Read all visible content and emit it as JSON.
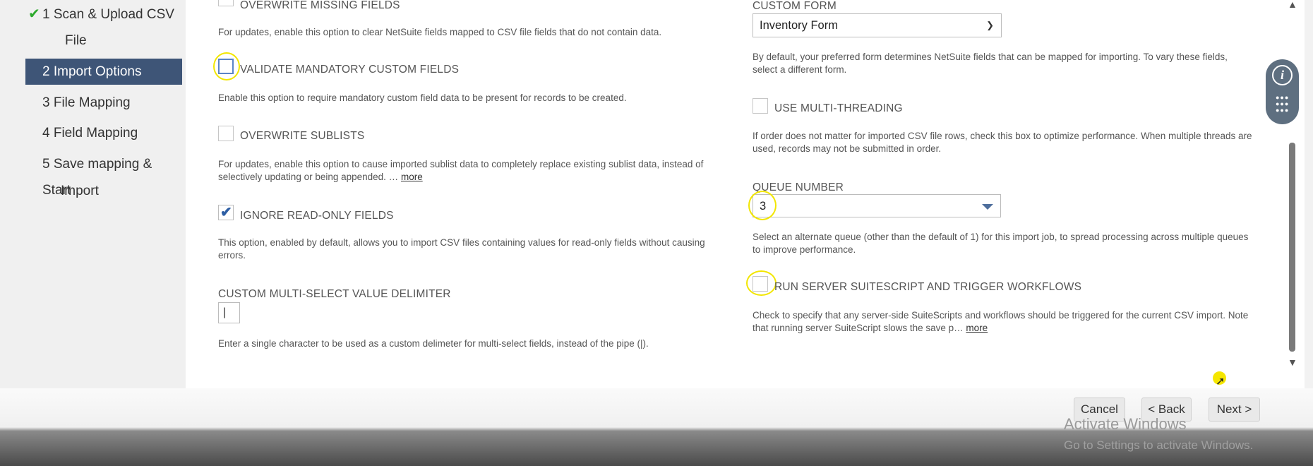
{
  "steps": [
    {
      "label": "1 Scan & Upload CSV",
      "label2": "File",
      "done": true
    },
    {
      "label": "2 Import Options",
      "active": true
    },
    {
      "label": "3 File Mapping"
    },
    {
      "label": "4 Field Mapping"
    },
    {
      "label": "5 Save mapping & Start",
      "label2": "Import"
    }
  ],
  "left": {
    "overwrite_missing": {
      "label": "OVERWRITE MISSING FIELDS",
      "help": "For updates, enable this option to clear NetSuite fields mapped to CSV file fields that do not contain data.",
      "checked": false
    },
    "validate_mandatory": {
      "label": "VALIDATE MANDATORY CUSTOM FIELDS",
      "help": "Enable this option to require mandatory custom field data to be present for records to be created.",
      "checked": false
    },
    "overwrite_sublists": {
      "label": "OVERWRITE SUBLISTS",
      "help1": "For updates, enable this option to cause imported sublist data to completely replace existing sublist data, instead of",
      "help2": "selectively updating or being appended. …",
      "more": "more",
      "checked": false
    },
    "ignore_readonly": {
      "label": "IGNORE READ-ONLY FIELDS",
      "help1": "This option, enabled by default, allows you to import CSV files containing values for read-only fields without causing",
      "help2": "errors.",
      "checked": true
    },
    "delimiter": {
      "label": "CUSTOM MULTI-SELECT VALUE DELIMITER",
      "value": "|",
      "help": "Enter a single character to be used as a custom delimeter for multi-select fields, instead of the pipe (|)."
    }
  },
  "right": {
    "custom_form": {
      "label": "CUSTOM FORM",
      "value": "Inventory Form",
      "help1": "By default, your preferred form determines NetSuite fields that can be mapped for importing. To vary these fields,",
      "help2": "select a different form."
    },
    "multithreading": {
      "label": "USE MULTI-THREADING",
      "help1": "If order does not matter for imported CSV file rows, check this box to optimize performance. When multiple threads are",
      "help2": "used, records may not be submitted in order.",
      "checked": false
    },
    "queue_number": {
      "label": "QUEUE NUMBER",
      "value": "3",
      "help1": "Select an alternate queue (other than the default of 1) for this import job, to spread processing across multiple queues",
      "help2": "to improve performance."
    },
    "run_suitescript": {
      "label": "RUN SERVER SUITESCRIPT AND TRIGGER WORKFLOWS",
      "help1": "Check to specify that any server-side SuiteScripts and workflows should be triggered for the current CSV import. Note",
      "help2": "that running server SuiteScript slows the save p…",
      "more": "more",
      "checked": false
    }
  },
  "buttons": {
    "cancel": "Cancel",
    "back": "< Back",
    "next": "Next >"
  },
  "watermark": {
    "line1": "Activate Windows",
    "line2": "Go to Settings to activate Windows."
  },
  "colors": {
    "active_nav": "#3e5577",
    "highlight": "#f2e600",
    "checkbox_tick": "#2d5ea4"
  }
}
